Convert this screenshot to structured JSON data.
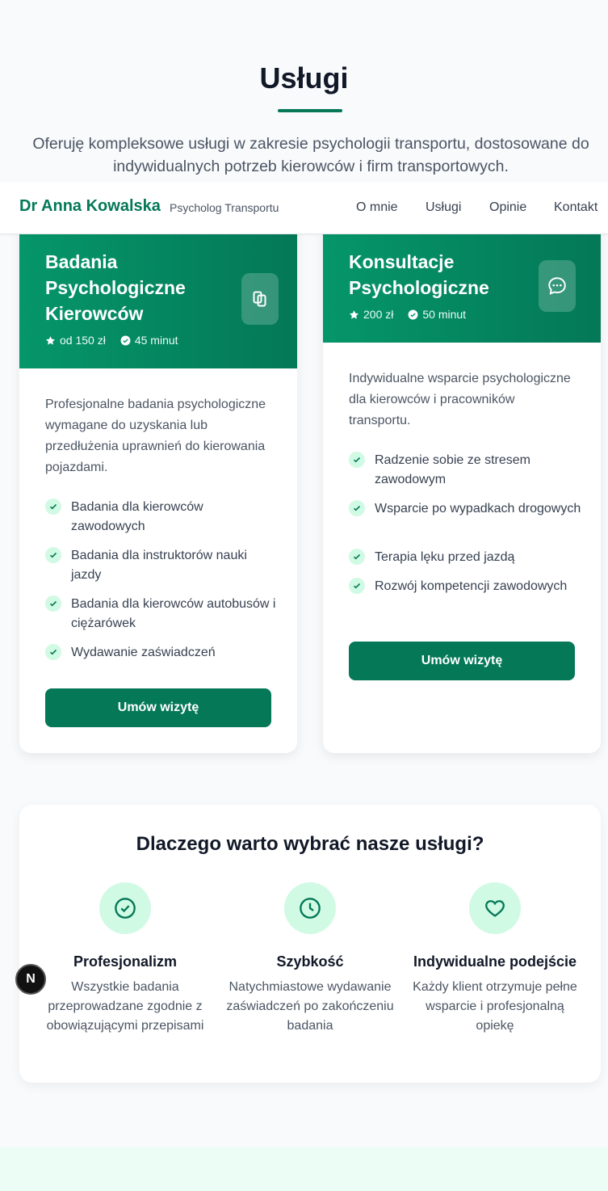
{
  "section": {
    "title": "Usługi",
    "intro": "Oferuję kompleksowe usługi w zakresie psychologii transportu, dostosowane do indywidualnych potrzeb kierowców i firm transportowych."
  },
  "navbar": {
    "brand": "Dr Anna Kowalska",
    "subtitle": "Psycholog Transportu",
    "links": [
      "O mnie",
      "Usługi",
      "Opinie",
      "Kontakt"
    ]
  },
  "cards": [
    {
      "title_lines": [
        "Badania",
        "Psychologiczne",
        "Kierowców"
      ],
      "price": "od 150 zł",
      "duration": "45 minut",
      "icon": "copy-icon",
      "description": "Profesjonalne badania psychologiczne wymagane do uzyskania lub przedłużenia uprawnień do kierowania pojazdami.",
      "features": [
        "Badania dla kierowców zawodowych",
        "Badania dla instruktorów nauki jazdy",
        "Badania dla kierowców autobusów i ciężarówek",
        "Wydawanie zaświadczeń"
      ],
      "cta": "Umów wizytę"
    },
    {
      "title_lines": [
        "Konsultacje",
        "Psychologiczne"
      ],
      "price": "200 zł",
      "duration": "50 minut",
      "icon": "chat-icon",
      "description": "Indywidualne wsparcie psychologiczne dla kierowców i pracowników transportu.",
      "features": [
        "Radzenie sobie ze stresem zawodowym",
        "Wsparcie po wypadkach drogowych",
        "Terapia lęku przed jazdą",
        "Rozwój kompetencji zawodowych"
      ],
      "cta": "Umów wizytę"
    }
  ],
  "why": {
    "title": "Dlaczego warto wybrać nasze usługi?",
    "items": [
      {
        "icon": "check-circle-icon",
        "title": "Profesjonalizm",
        "text": "Wszystkie badania przeprowadzane zgodnie z obowiązującymi przepisami"
      },
      {
        "icon": "clock-icon",
        "title": "Szybkość",
        "text": "Natychmiastowe wydawanie zaświadczeń po zakończeniu badania"
      },
      {
        "icon": "heart-icon",
        "title": "Indywidualne podejście",
        "text": "Każdy klient otrzymuje pełne wsparcie i profesjonalną opiekę"
      }
    ]
  },
  "badge": "N",
  "colors": {
    "accent": "#047857",
    "accent_light": "#d1fae5"
  }
}
